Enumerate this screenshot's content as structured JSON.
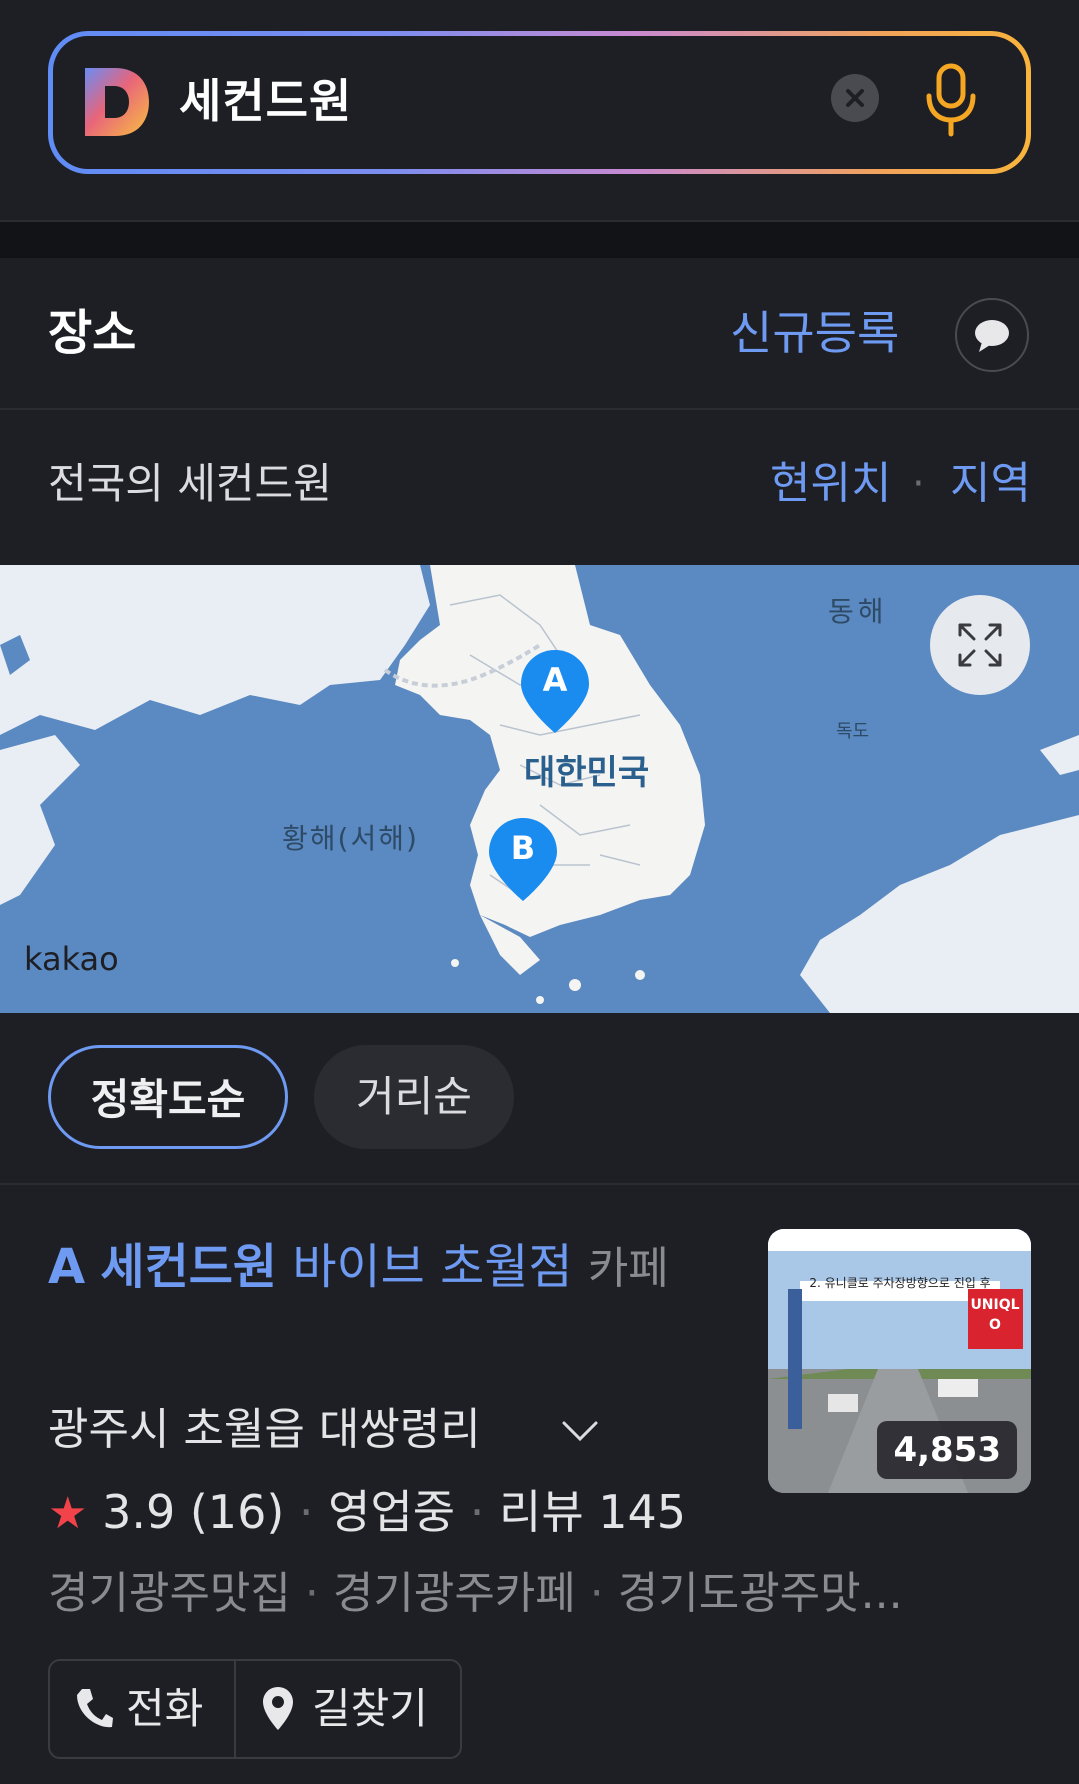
{
  "search": {
    "query": "세컨드원"
  },
  "section": {
    "title": "장소",
    "register_label": "신규등록"
  },
  "filter": {
    "scope_text": "전국의 세컨드원",
    "current_location": "현위치",
    "separator": "·",
    "region": "지역"
  },
  "map": {
    "labels": {
      "country": "대한민국",
      "east_sea": "동해",
      "dokdo": "독도",
      "yellow_sea": "황해(서해)",
      "provider": "kakao"
    },
    "markers": [
      {
        "letter": "A"
      },
      {
        "letter": "B"
      }
    ]
  },
  "sort": {
    "accuracy": "정확도순",
    "distance": "거리순"
  },
  "result": {
    "letter": "A",
    "name_bold": "세컨드원",
    "name_rest": "바이브 초월점",
    "category": "카페",
    "address": "광주시 초월읍 대쌍령리",
    "rating": "3.9",
    "rating_count": "(16)",
    "status": "영업중",
    "review_label": "리뷰 145",
    "tags": [
      "경기광주맛집",
      "경기광주카페",
      "경기도광주맛..."
    ],
    "thumb_count": "4,853",
    "thumb_sign_text": "2. 유니클로 주차장방향으로 진입 후",
    "thumb_store": "UNIQLO",
    "call_label": "전화",
    "route_label": "길찾기"
  },
  "colors": {
    "accent": "#6e9af2",
    "background": "#1e1f24",
    "star": "#f2424a",
    "map_sea": "#5b89c1"
  }
}
